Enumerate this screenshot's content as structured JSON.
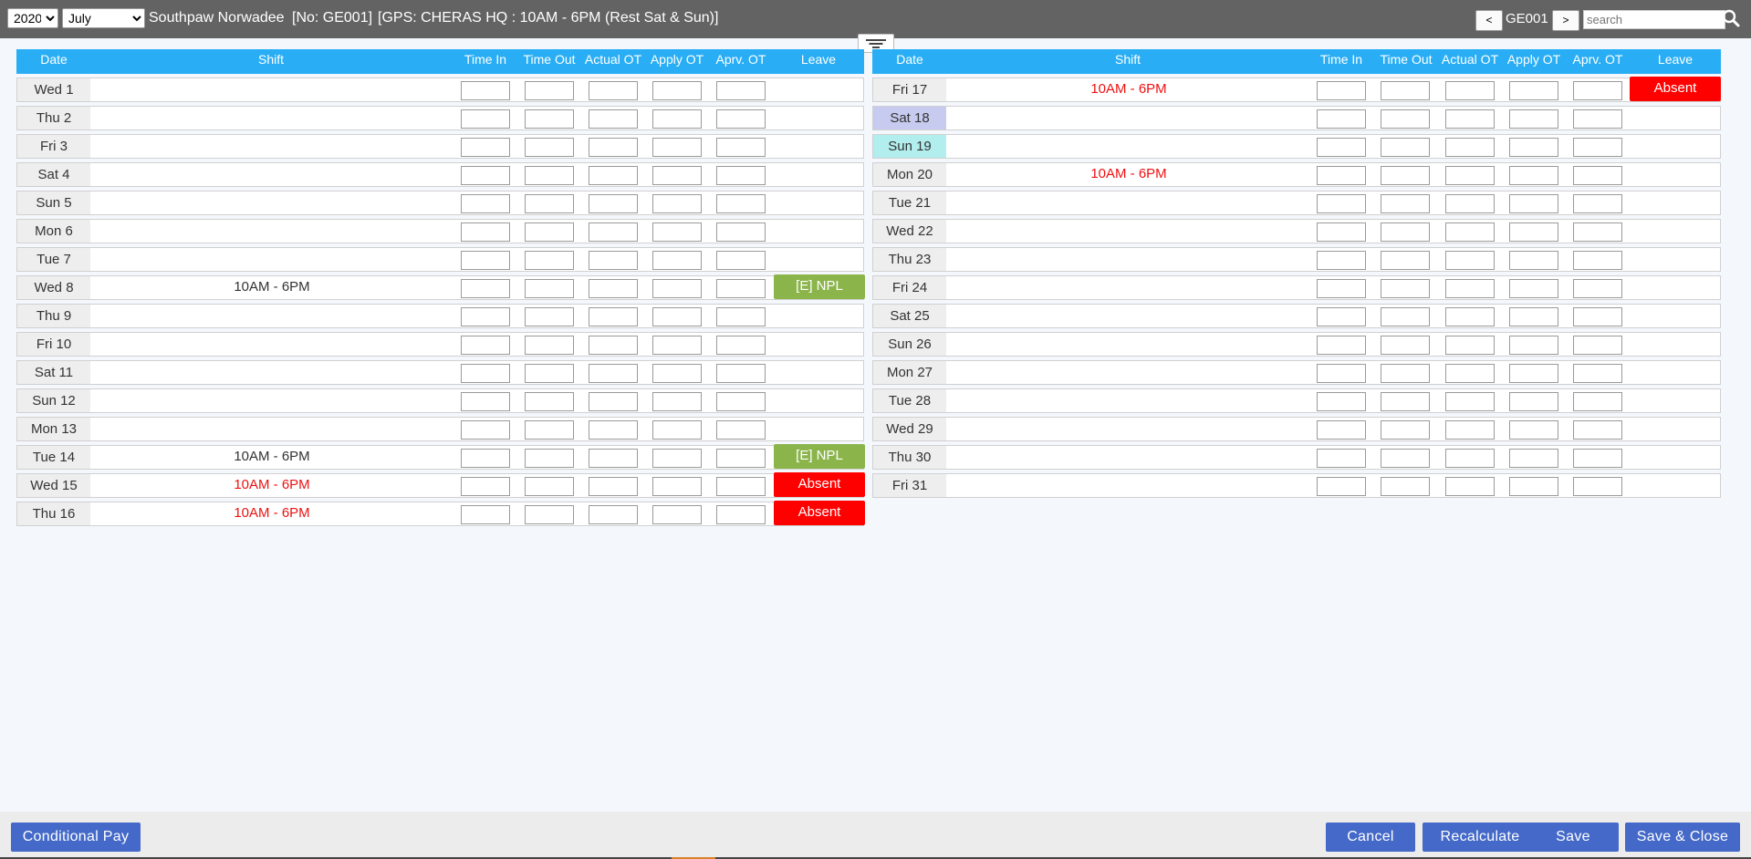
{
  "header": {
    "year": "2020",
    "month": "July",
    "employee_name": "Southpaw Norwadee",
    "employee_no": "[No: GE001]",
    "gps_info": "[GPS: CHERAS HQ : 10AM - 6PM (Rest Sat & Sun)]",
    "prev_label": "<",
    "next_label": ">",
    "employee_code": "GE001",
    "search_placeholder": "search",
    "icons": {
      "search": "search-icon",
      "filter": "filter-icon"
    }
  },
  "columns": {
    "date": "Date",
    "shift": "Shift",
    "time_in": "Time In",
    "time_out": "Time Out",
    "actual_ot": "Actual OT",
    "apply_ot": "Apply OT",
    "aprv_ot": "Aprv. OT",
    "leave": "Leave"
  },
  "left_rows": [
    {
      "date": "Wed 1",
      "shift": "",
      "leave": ""
    },
    {
      "date": "Thu 2",
      "shift": "",
      "leave": ""
    },
    {
      "date": "Fri 3",
      "shift": "",
      "leave": ""
    },
    {
      "date": "Sat 4",
      "shift": "",
      "leave": ""
    },
    {
      "date": "Sun 5",
      "shift": "",
      "leave": ""
    },
    {
      "date": "Mon 6",
      "shift": "",
      "leave": ""
    },
    {
      "date": "Tue 7",
      "shift": "",
      "leave": ""
    },
    {
      "date": "Wed 8",
      "shift": "10AM - 6PM",
      "shift_color": "#333333",
      "leave": "[E] NPL",
      "leave_type": "npl"
    },
    {
      "date": "Thu 9",
      "shift": "",
      "leave": ""
    },
    {
      "date": "Fri 10",
      "shift": "",
      "leave": ""
    },
    {
      "date": "Sat 11",
      "shift": "",
      "leave": ""
    },
    {
      "date": "Sun 12",
      "shift": "",
      "leave": ""
    },
    {
      "date": "Mon 13",
      "shift": "",
      "leave": ""
    },
    {
      "date": "Tue 14",
      "shift": "10AM - 6PM",
      "shift_color": "#333333",
      "leave": "[E] NPL",
      "leave_type": "npl"
    },
    {
      "date": "Wed 15",
      "shift": "10AM - 6PM",
      "shift_color": "#ee1111",
      "leave": "Absent",
      "leave_type": "absent"
    },
    {
      "date": "Thu 16",
      "shift": "10AM - 6PM",
      "shift_color": "#ee1111",
      "leave": "Absent",
      "leave_type": "absent"
    }
  ],
  "right_rows": [
    {
      "date": "Fri 17",
      "shift": "10AM - 6PM",
      "shift_color": "#ee1111",
      "leave": "Absent",
      "leave_type": "absent"
    },
    {
      "date": "Sat 18",
      "shift": "",
      "leave": "",
      "highlight": "sat"
    },
    {
      "date": "Sun 19",
      "shift": "",
      "leave": "",
      "highlight": "sun"
    },
    {
      "date": "Mon 20",
      "shift": "10AM - 6PM",
      "shift_color": "#ee1111",
      "leave": ""
    },
    {
      "date": "Tue 21",
      "shift": "",
      "leave": ""
    },
    {
      "date": "Wed 22",
      "shift": "",
      "leave": ""
    },
    {
      "date": "Thu 23",
      "shift": "",
      "leave": ""
    },
    {
      "date": "Fri 24",
      "shift": "",
      "leave": ""
    },
    {
      "date": "Sat 25",
      "shift": "",
      "leave": ""
    },
    {
      "date": "Sun 26",
      "shift": "",
      "leave": ""
    },
    {
      "date": "Mon 27",
      "shift": "",
      "leave": ""
    },
    {
      "date": "Tue 28",
      "shift": "",
      "leave": ""
    },
    {
      "date": "Wed 29",
      "shift": "",
      "leave": ""
    },
    {
      "date": "Thu 30",
      "shift": "",
      "leave": ""
    },
    {
      "date": "Fri 31",
      "shift": "",
      "leave": ""
    }
  ],
  "footer": {
    "conditional_pay": "Conditional Pay",
    "cancel": "Cancel",
    "recalculate": "Recalculate",
    "save": "Save",
    "save_close": "Save & Close"
  },
  "colors": {
    "header_bar": "#636363",
    "table_header": "#29aef5",
    "button": "#4469c8",
    "absent": "#ff0000",
    "npl": "#8bb54b",
    "sat_highlight": "#c7cbef",
    "sun_highlight": "#b2eeee"
  }
}
